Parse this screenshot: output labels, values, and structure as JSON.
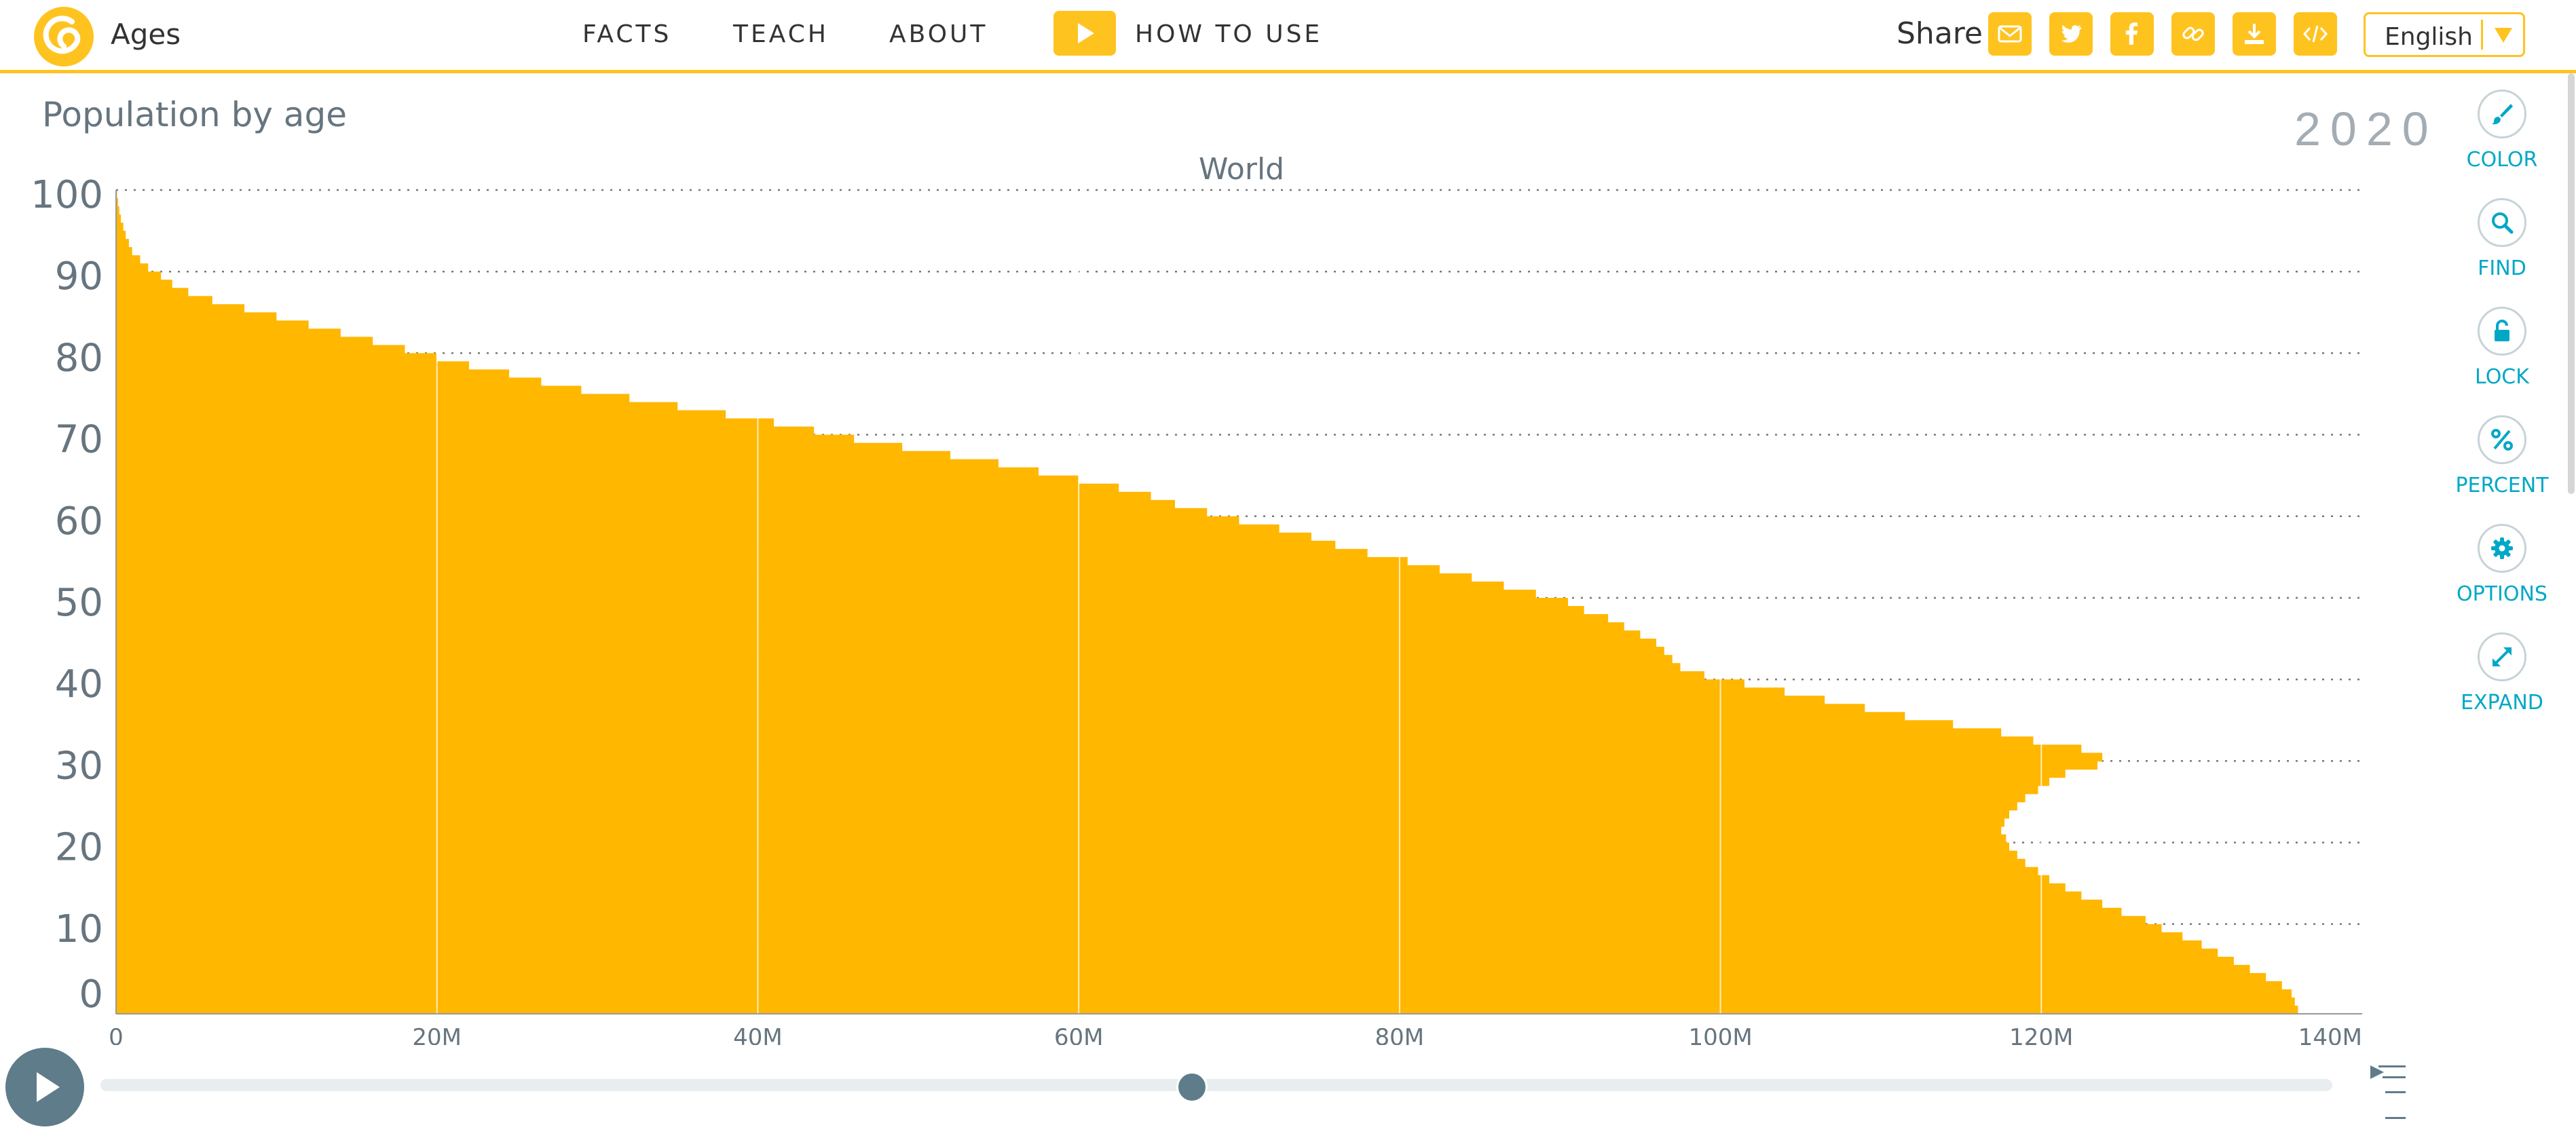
{
  "header": {
    "app_name": "Ages",
    "nav": [
      "FACTS",
      "TEACH",
      "ABOUT"
    ],
    "how_to_use": "HOW TO USE",
    "share_label": "Share",
    "share_icons": [
      "email-icon",
      "twitter-icon",
      "facebook-icon",
      "link-icon",
      "download-icon",
      "embed-icon"
    ],
    "language": "English"
  },
  "chart": {
    "title": "Population by age",
    "year": "2020",
    "entity": "World"
  },
  "tools": [
    {
      "icon": "brush-icon",
      "label": "COLOR"
    },
    {
      "icon": "search-icon",
      "label": "FIND"
    },
    {
      "icon": "lock-open-icon",
      "label": "LOCK"
    },
    {
      "icon": "percent-icon",
      "label": "PERCENT"
    },
    {
      "icon": "gear-icon",
      "label": "OPTIONS"
    },
    {
      "icon": "expand-icon",
      "label": "EXPAND"
    }
  ],
  "timeslider": {
    "icon": "play-icon",
    "position": 0.488,
    "forecast_icon": "forecast-icon"
  },
  "colors": {
    "accent": "#ffc320",
    "bars": "#ffb700",
    "slider": "#5f7c8a",
    "tool_text": "#00a8c6",
    "axis_text": "#66757f"
  },
  "chart_data": {
    "type": "bar",
    "orientation": "horizontal",
    "title": "Population by age",
    "entity": "World",
    "year": 2020,
    "ylabel": "",
    "xlabel": "",
    "y_ticks": [
      0,
      10,
      20,
      30,
      40,
      50,
      60,
      70,
      80,
      90,
      100
    ],
    "x_ticks": [
      "0",
      "20M",
      "40M",
      "60M",
      "80M",
      "100M",
      "120M",
      "140M"
    ],
    "xlim": [
      0,
      140000000
    ],
    "ylim": [
      0,
      100
    ],
    "grid": "dotted horizontal at y ticks, vertical at x ticks",
    "ages": [
      0,
      1,
      2,
      3,
      4,
      5,
      6,
      7,
      8,
      9,
      10,
      11,
      12,
      13,
      14,
      15,
      16,
      17,
      18,
      19,
      20,
      21,
      22,
      23,
      24,
      25,
      26,
      27,
      28,
      29,
      30,
      31,
      32,
      33,
      34,
      35,
      36,
      37,
      38,
      39,
      40,
      41,
      42,
      43,
      44,
      45,
      46,
      47,
      48,
      49,
      50,
      51,
      52,
      53,
      54,
      55,
      56,
      57,
      58,
      59,
      60,
      61,
      62,
      63,
      64,
      65,
      66,
      67,
      68,
      69,
      70,
      71,
      72,
      73,
      74,
      75,
      76,
      77,
      78,
      79,
      80,
      81,
      82,
      83,
      84,
      85,
      86,
      87,
      88,
      89,
      90,
      91,
      92,
      93,
      94,
      95,
      96,
      97,
      98,
      99,
      100
    ],
    "values_millions": [
      136.0,
      135.8,
      135.6,
      135.0,
      134.0,
      133.0,
      132.0,
      131.0,
      130.0,
      128.8,
      127.5,
      126.5,
      125.0,
      123.8,
      122.5,
      121.5,
      120.5,
      119.8,
      119.0,
      118.5,
      118.0,
      117.8,
      117.5,
      117.7,
      118.0,
      118.5,
      119.0,
      119.8,
      120.5,
      121.5,
      123.5,
      123.8,
      122.5,
      119.5,
      117.5,
      114.5,
      111.5,
      109.0,
      106.5,
      104.0,
      101.5,
      99.0,
      97.5,
      97.0,
      96.5,
      96.0,
      95.0,
      94.0,
      93.0,
      91.5,
      90.5,
      88.5,
      86.5,
      84.5,
      82.5,
      80.5,
      78.0,
      76.0,
      74.5,
      72.5,
      70.0,
      68.0,
      66.0,
      64.5,
      62.5,
      60.0,
      57.5,
      55.0,
      52.0,
      49.0,
      46.0,
      43.5,
      41.0,
      38.0,
      35.0,
      32.0,
      29.0,
      26.5,
      24.5,
      22.0,
      20.0,
      18.0,
      16.0,
      14.0,
      12.0,
      10.0,
      8.0,
      6.0,
      4.5,
      3.5,
      2.8,
      2.0,
      1.5,
      1.0,
      0.8,
      0.6,
      0.45,
      0.3,
      0.2,
      0.12,
      0.06
    ]
  }
}
